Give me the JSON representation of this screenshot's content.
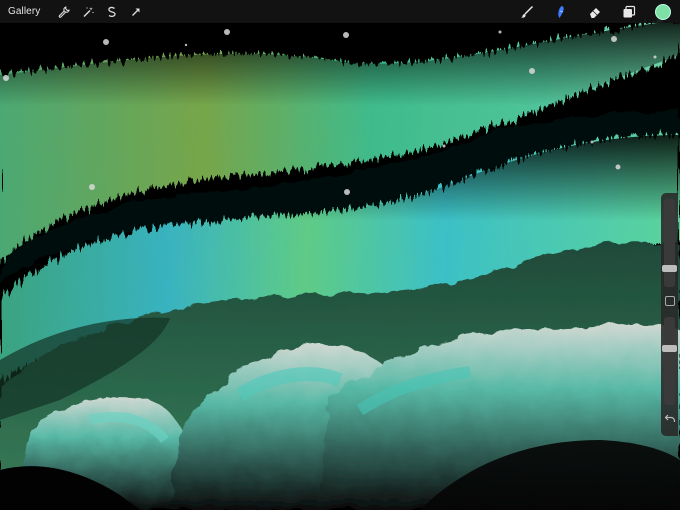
{
  "topbar": {
    "gallery_label": "Gallery",
    "left_tools": [
      "wrench-icon",
      "magic-wand-icon",
      "selection-icon",
      "transform-arrow-icon"
    ],
    "right_tools": [
      "brush-icon",
      "smudge-icon",
      "eraser-icon",
      "layers-icon"
    ]
  },
  "colors": {
    "current_color": "#7fe0a6",
    "smudge_active": "#3d7bff"
  },
  "sidebar": {
    "brush_size_level": 0.18,
    "opacity_level": 0.65,
    "modify_button": "square-modify-icon",
    "undo": "undo-icon"
  }
}
